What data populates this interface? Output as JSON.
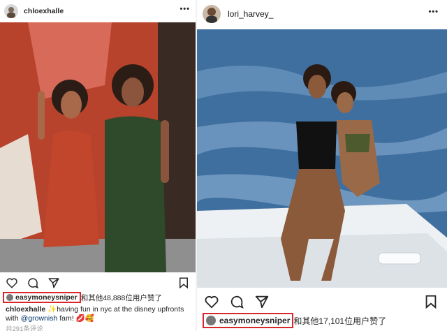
{
  "left_post": {
    "username": "chloexhalle",
    "more_label": "•••",
    "liker": "easymoneysniper",
    "likes_text": "和其他48,888位用户赞了",
    "caption": {
      "user": "chloexhalle",
      "text": "✨having fun in nyc at the disney upfronts with",
      "mention": "@grownish",
      "tail": "fam! 💋🥰"
    },
    "comments_text": "共291条评论"
  },
  "right_post": {
    "username": "lori_harvey_",
    "more_label": "•••",
    "liker": "easymoneysniper",
    "likes_text": "和其他17,101位用户赞了"
  },
  "colors": {
    "highlight": "#d9262c",
    "wall_red": "#b8432c",
    "sea": "#3f6f9f"
  }
}
